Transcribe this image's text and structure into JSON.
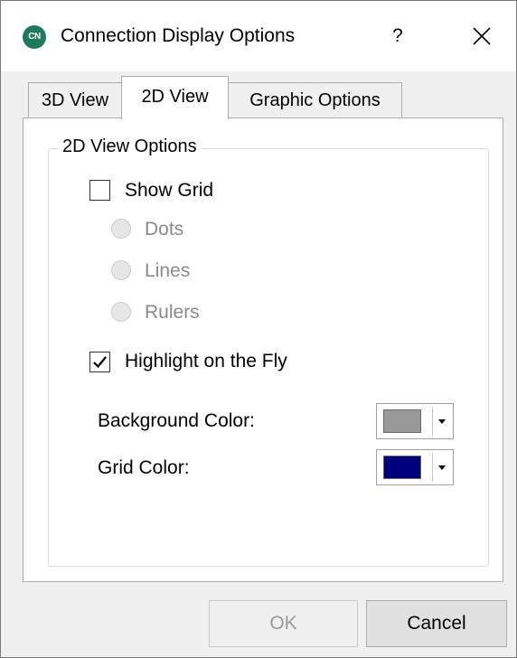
{
  "window": {
    "icon_text": "CN",
    "title": "Connection Display Options",
    "help_label": "?"
  },
  "tabs": [
    {
      "label": "3D View",
      "selected": false
    },
    {
      "label": "2D View",
      "selected": true
    },
    {
      "label": "Graphic Options",
      "selected": false
    }
  ],
  "group": {
    "title": "2D View Options",
    "show_grid": {
      "label": "Show Grid",
      "checked": false
    },
    "grid_styles": [
      {
        "label": "Dots",
        "enabled": false
      },
      {
        "label": "Lines",
        "enabled": false
      },
      {
        "label": "Rulers",
        "enabled": false
      }
    ],
    "highlight": {
      "label": "Highlight on the Fly",
      "checked": true
    },
    "background_color": {
      "label": "Background Color:",
      "value": "#999999"
    },
    "grid_color": {
      "label": "Grid Color:",
      "value": "#00007f"
    }
  },
  "buttons": {
    "ok": "OK",
    "cancel": "Cancel"
  }
}
